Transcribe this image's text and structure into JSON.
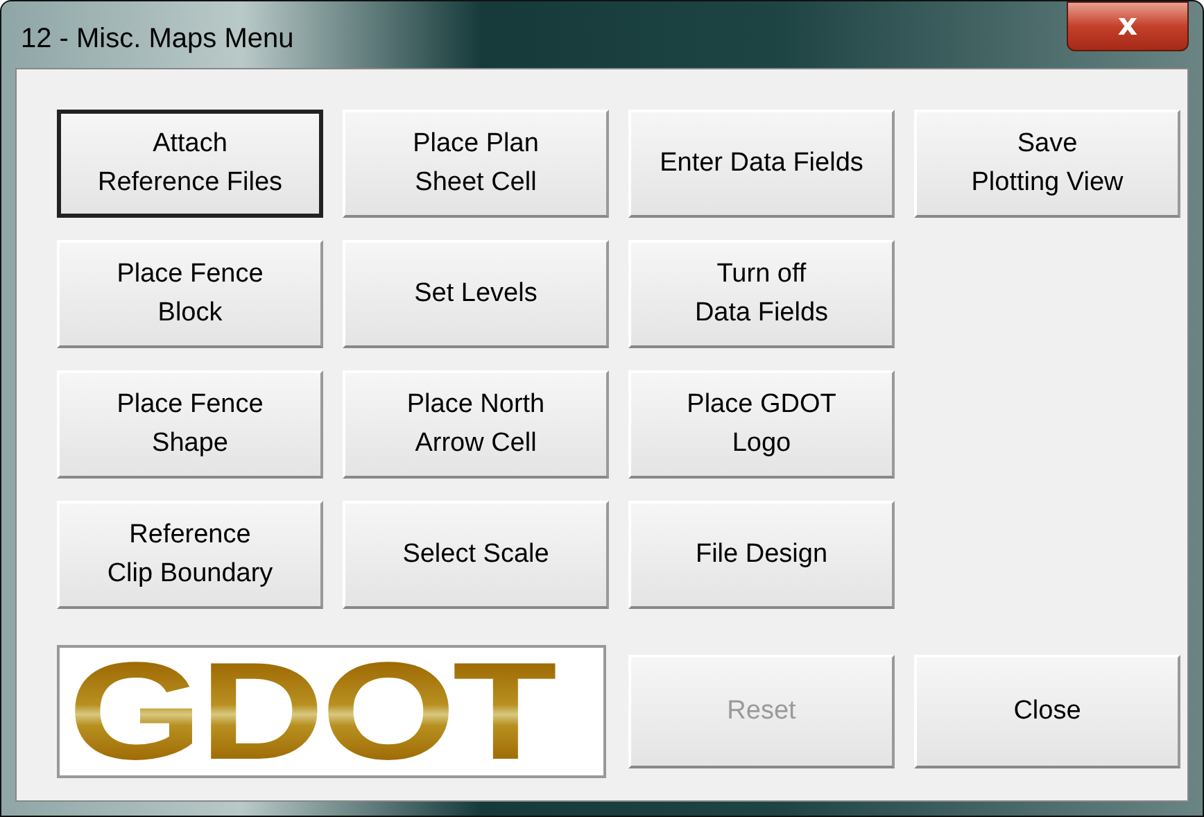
{
  "window": {
    "title": "12 - Misc. Maps Menu",
    "close_label": "x"
  },
  "button_rows": [
    [
      {
        "label": "Attach\nReference Files",
        "default": true,
        "disabled": false
      },
      {
        "label": "Place Plan\nSheet Cell",
        "default": false,
        "disabled": false
      },
      {
        "label": "Enter Data Fields",
        "default": false,
        "disabled": false
      },
      {
        "label": "Save\nPlotting View",
        "default": false,
        "disabled": false
      }
    ],
    [
      {
        "label": "Place Fence\nBlock",
        "default": false,
        "disabled": false
      },
      {
        "label": "Set Levels",
        "default": false,
        "disabled": false
      },
      {
        "label": "Turn off\nData Fields",
        "default": false,
        "disabled": false
      }
    ],
    [
      {
        "label": "Place Fence\nShape",
        "default": false,
        "disabled": false
      },
      {
        "label": "Place North\nArrow Cell",
        "default": false,
        "disabled": false
      },
      {
        "label": "Place GDOT\nLogo",
        "default": false,
        "disabled": false
      }
    ],
    [
      {
        "label": "Reference\nClip Boundary",
        "default": false,
        "disabled": false
      },
      {
        "label": "Select Scale",
        "default": false,
        "disabled": false
      },
      {
        "label": "File Design",
        "default": false,
        "disabled": false
      }
    ]
  ],
  "logo": {
    "text": "GDOT"
  },
  "bottom_buttons": [
    {
      "label": "Reset",
      "default": false,
      "disabled": true
    },
    {
      "label": "Close",
      "default": false,
      "disabled": false
    }
  ]
}
